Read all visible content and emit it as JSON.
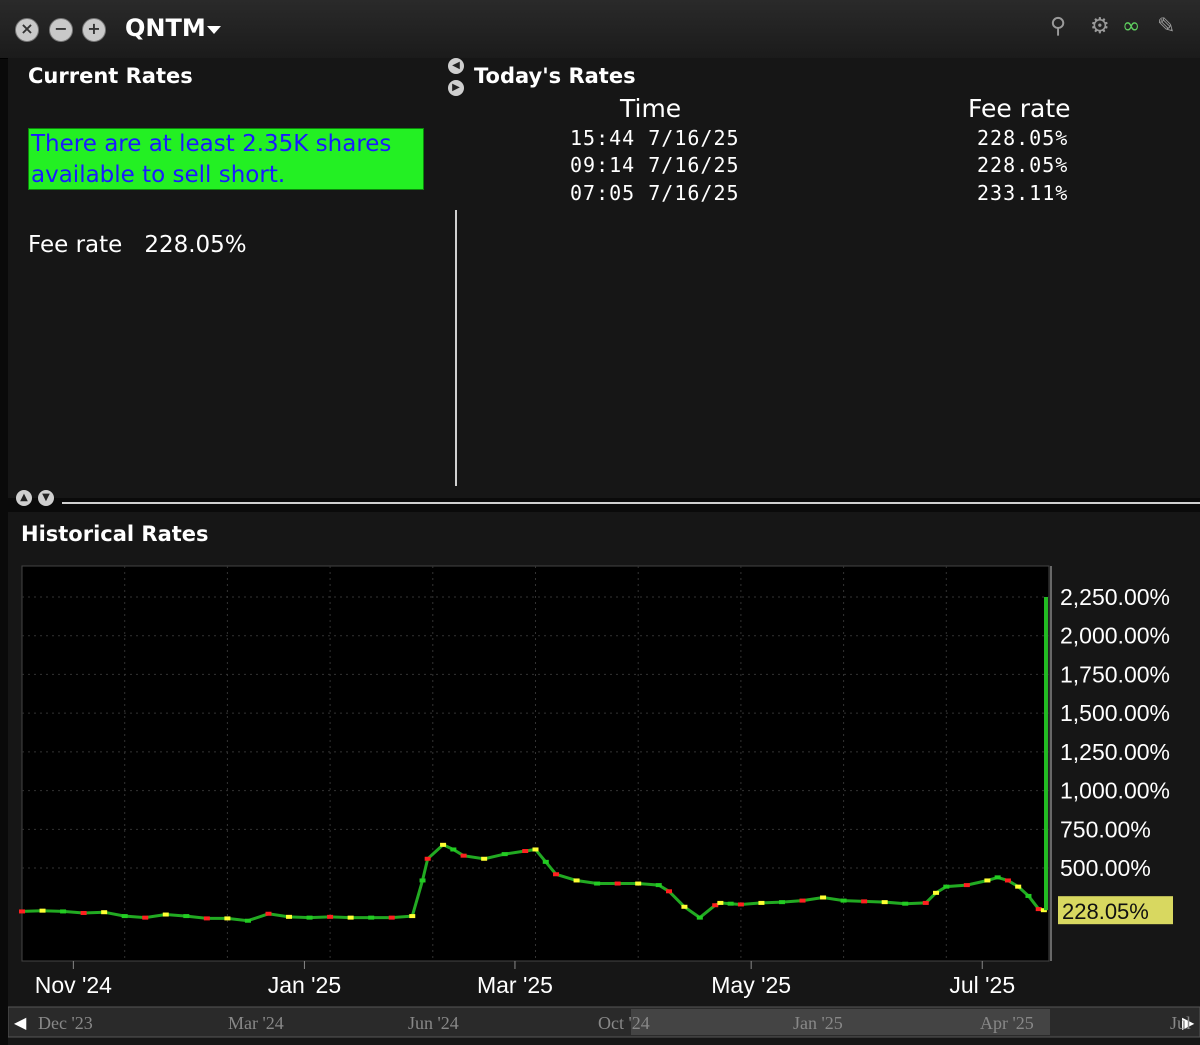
{
  "window": {
    "symbol": "QNTM",
    "close_icon": "close-icon",
    "minimize_icon": "minimize-icon",
    "maximize_icon": "maximize-icon"
  },
  "current_rates": {
    "title": "Current Rates",
    "availability_line1": "There are at least 2.35K shares",
    "availability_line2": "available to sell short.",
    "availability_bg": "#23f023",
    "fee_label": "Fee rate",
    "fee_value": "228.05%"
  },
  "todays_rates": {
    "title": "Today's Rates",
    "col_time": "Time",
    "col_fee": "Fee rate",
    "rows": [
      {
        "time": "15:44  7/16/25",
        "fee": "228.05%"
      },
      {
        "time": "09:14  7/16/25",
        "fee": "228.05%"
      },
      {
        "time": "07:05  7/16/25",
        "fee": "233.11%"
      }
    ]
  },
  "historical": {
    "title": "Historical Rates"
  },
  "chart_data": {
    "type": "line",
    "y_ticks": [
      "2,250.00%",
      "2,000.00%",
      "1,750.00%",
      "1,500.00%",
      "1,250.00%",
      "1,000.00%",
      "750.00%",
      "500.00%"
    ],
    "y_tick_values": [
      2250,
      2000,
      1750,
      1500,
      1250,
      1000,
      750,
      500
    ],
    "ylim": [
      -100,
      2450
    ],
    "x_ticks": [
      "Nov '24",
      "Jan '25",
      "Mar '25",
      "May '25",
      "Jul '25"
    ],
    "x_tick_pos": [
      0.05,
      0.275,
      0.48,
      0.71,
      0.935
    ],
    "current_value": 228.05,
    "current_label": "228.05%",
    "navigator_ticks": [
      "Dec '23",
      "Mar '24",
      "Jun '24",
      "Oct '24",
      "Jan '25",
      "Apr '25",
      "Jul"
    ],
    "x": [
      0.0,
      0.02,
      0.04,
      0.06,
      0.08,
      0.1,
      0.12,
      0.14,
      0.16,
      0.18,
      0.2,
      0.22,
      0.24,
      0.26,
      0.28,
      0.3,
      0.32,
      0.34,
      0.36,
      0.38,
      0.39,
      0.395,
      0.41,
      0.42,
      0.43,
      0.45,
      0.47,
      0.49,
      0.5,
      0.51,
      0.52,
      0.54,
      0.56,
      0.58,
      0.6,
      0.62,
      0.63,
      0.645,
      0.66,
      0.675,
      0.68,
      0.69,
      0.7,
      0.72,
      0.74,
      0.76,
      0.78,
      0.8,
      0.82,
      0.84,
      0.86,
      0.88,
      0.89,
      0.9,
      0.92,
      0.94,
      0.95,
      0.96,
      0.97,
      0.98,
      0.99,
      0.995
    ],
    "y": [
      220,
      225,
      220,
      210,
      215,
      190,
      180,
      200,
      190,
      175,
      175,
      160,
      205,
      185,
      180,
      185,
      180,
      180,
      180,
      190,
      420,
      560,
      650,
      620,
      580,
      560,
      590,
      610,
      620,
      540,
      460,
      420,
      400,
      400,
      400,
      390,
      350,
      250,
      180,
      260,
      275,
      270,
      265,
      275,
      280,
      290,
      310,
      290,
      285,
      280,
      270,
      275,
      340,
      380,
      390,
      420,
      440,
      420,
      380,
      320,
      235,
      228
    ]
  }
}
